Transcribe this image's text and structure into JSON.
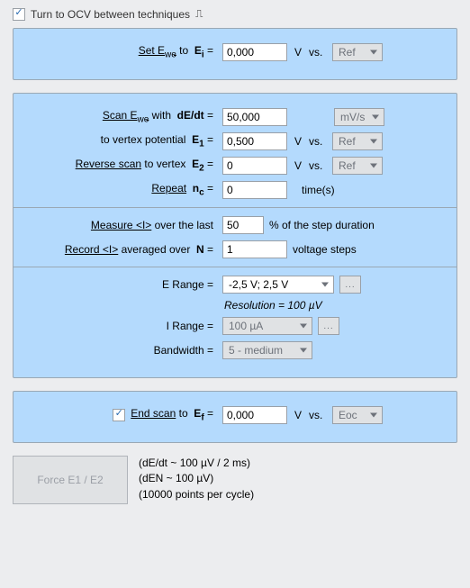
{
  "top": {
    "checkbox_label": "Turn to OCV between techniques",
    "checked": true
  },
  "setE": {
    "value": "0,000",
    "unit": "V",
    "vs": "vs.",
    "ref": "Ref"
  },
  "scan": {
    "dEdt_value": "50,000",
    "dEdt_unit": "mV/s",
    "E1_label_prefix": "to vertex potential",
    "E1_value": "0,500",
    "E1_unit": "V",
    "E1_vs": "vs.",
    "E1_ref": "Ref",
    "E2_value": "0",
    "E2_unit": "V",
    "E2_vs": "vs.",
    "E2_ref": "Ref",
    "nc_value": "0",
    "nc_unit": "time(s)"
  },
  "measure": {
    "last_value": "50",
    "last_suffix": "% of the step duration",
    "N_value": "1",
    "N_suffix": "voltage steps"
  },
  "ranges": {
    "ERange_label": "E Range =",
    "ERange_value": "-2,5 V; 2,5 V",
    "resolution": "Resolution = 100 µV",
    "IRange_label": "I Range =",
    "IRange_value": "100 µA",
    "Bandwidth_label": "Bandwidth =",
    "Bandwidth_value": "5 - medium"
  },
  "end": {
    "value": "0,000",
    "unit": "V",
    "vs": "vs.",
    "ref": "Eoc"
  },
  "footer": {
    "button": "Force E1 / E2",
    "line1": "(dE/dt ~ 100 µV / 2 ms)",
    "line2": "(dEN ~ 100 µV)",
    "line3": "(10000 points per cycle)"
  }
}
